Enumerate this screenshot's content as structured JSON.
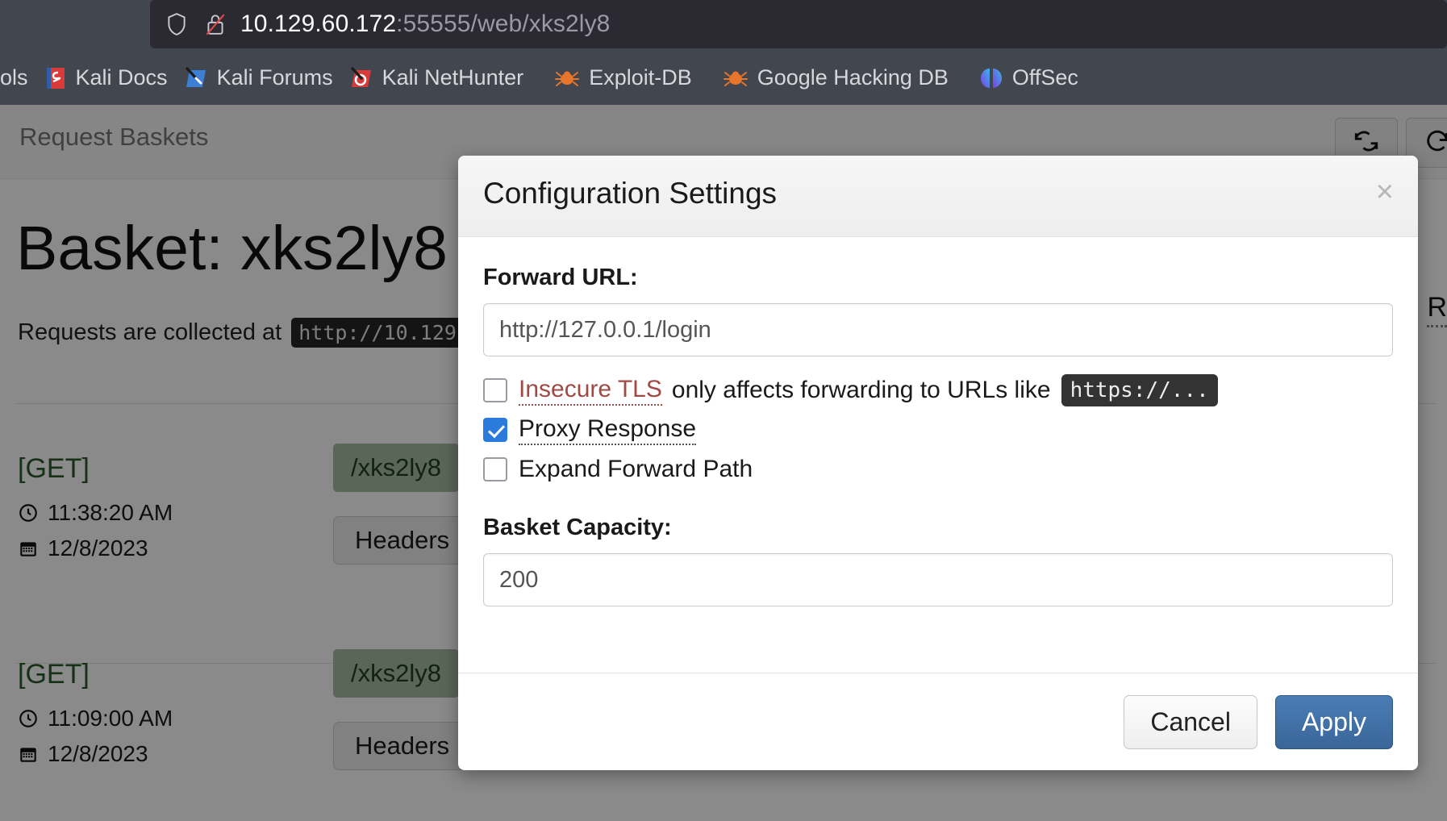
{
  "browser": {
    "url_host": "10.129.60.172",
    "url_rest": ":55555/web/xks2ly8",
    "shield_icon": "shield-icon",
    "lock_broken_icon": "lock-broken-icon",
    "bookmarks": [
      {
        "label": "ols",
        "icon": "truncated-bookmark-icon"
      },
      {
        "label": "Kali Docs",
        "icon": "kali-docs-icon"
      },
      {
        "label": "Kali Forums",
        "icon": "kali-forums-icon"
      },
      {
        "label": "Kali NetHunter",
        "icon": "kali-nethunter-icon"
      },
      {
        "label": "Exploit-DB",
        "icon": "exploit-db-bug-icon"
      },
      {
        "label": "Google Hacking DB",
        "icon": "google-hacking-db-bug-icon"
      },
      {
        "label": "OffSec",
        "icon": "offsec-icon"
      }
    ]
  },
  "page": {
    "brand": "Request Baskets",
    "nav_buttons": [
      {
        "name": "refresh-button",
        "icon": "sync-icon"
      },
      {
        "name": "reload-button",
        "icon": "refresh-icon"
      }
    ],
    "basket_title": "Basket: xks2ly8",
    "collect_prefix": "Requests are collected at",
    "collect_url": "http://10.129.",
    "responses_label": "R",
    "requests": [
      {
        "method": "[GET]",
        "time": "11:38:20 AM",
        "date": "12/8/2023",
        "path": "/xks2ly8",
        "headers_label": "Headers",
        "clock_icon": "clock-icon",
        "calendar_icon": "calendar-icon"
      },
      {
        "method": "[GET]",
        "time": "11:09:00 AM",
        "date": "12/8/2023",
        "path": "/xks2ly8",
        "headers_label": "Headers",
        "clock_icon": "clock-icon",
        "calendar_icon": "calendar-icon"
      }
    ]
  },
  "modal": {
    "title": "Configuration Settings",
    "close_label": "×",
    "forward_url_label": "Forward URL:",
    "forward_url_value": "http://127.0.0.1/login",
    "insecure_tls_link": "Insecure TLS",
    "insecure_tls_rest": "only affects forwarding to URLs like",
    "insecure_tls_code": "https://...",
    "insecure_tls_checked": false,
    "proxy_response_label": "Proxy Response",
    "proxy_response_checked": true,
    "expand_forward_path_label": "Expand Forward Path",
    "expand_forward_path_checked": false,
    "capacity_label": "Basket Capacity:",
    "capacity_value": "200",
    "cancel_label": "Cancel",
    "apply_label": "Apply",
    "accent_color": "#3a6699",
    "checkbox_checked_color": "#2a7bdb",
    "tooltip_link_color": "#a04a46"
  }
}
